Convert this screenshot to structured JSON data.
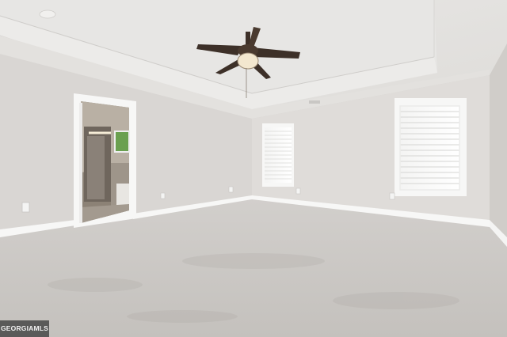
{
  "watermark": {
    "text": "GEORGIAMLS"
  },
  "colors": {
    "ceiling": "#e6e4e1",
    "walls": "#dcd9d6",
    "side_wall": "#d3d0cc",
    "carpet": "#c9c6c3",
    "trim": "#f7f7f6",
    "fan_blades": "#3d3028",
    "fan_light": "#f3e7cf"
  },
  "icons": [
    "ceiling-fan-icon",
    "window-blinds-icon",
    "doorway-icon",
    "smoke-detector-icon",
    "outlet-icon"
  ]
}
